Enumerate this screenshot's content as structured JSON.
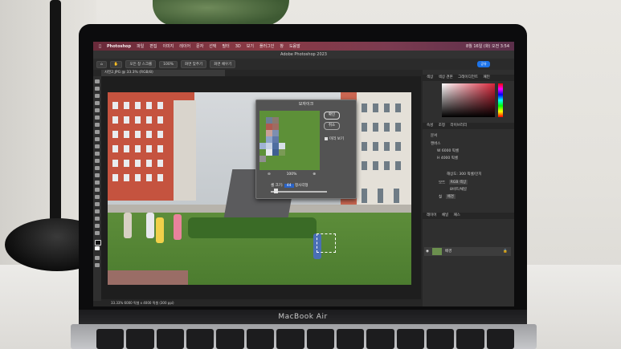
{
  "app": {
    "name": "Photoshop",
    "window_title": "Adobe Photoshop 2023"
  },
  "menubar": {
    "items": [
      "파일",
      "편집",
      "이미지",
      "레이어",
      "문자",
      "선택",
      "필터",
      "3D",
      "보기",
      "플러그인",
      "창",
      "도움말"
    ],
    "clock": "8월 16일 (화) 오전 3:54"
  },
  "options_bar": {
    "buttons": [
      "모든 창 스크롤",
      "100%",
      "화면 맞추기",
      "화면 채우기"
    ],
    "share_label": "공유"
  },
  "document_tab": "사진2.JPG @ 33.3% (RGB/8)",
  "dialog": {
    "title": "모자이크",
    "ok_label": "확인",
    "cancel_label": "취소",
    "preview_label": "미리 보기",
    "zoom_value": "100%",
    "cell_size_label": "셀 크기:",
    "cell_size_value": "44",
    "cell_size_unit": "정사각형"
  },
  "right_panel": {
    "top_tabs": [
      "색상",
      "색상 견본",
      "그레이디언트",
      "패턴"
    ],
    "mid_tabs": [
      "속성",
      "조정",
      "라이브러리"
    ],
    "doc_label": "문서",
    "canvas_label": "캔버스",
    "width_label": "W",
    "width_value": "6000 픽셀",
    "height_label": "H",
    "height_value": "4000 픽셀",
    "resolution": "해상도: 300 픽셀/인치",
    "mode_label": "모드",
    "mode_value": "RGB 색상",
    "bit_value": "8비트/채널",
    "fill_label": "칠",
    "fill_value": "배경",
    "layers_tabs": [
      "레이어",
      "채널",
      "패스"
    ],
    "layer_name": "배경"
  },
  "status_bar": "33.33%   6000 픽셀 x 4000 픽셀 (300 ppi)",
  "laptop_label": "MacBook Air"
}
